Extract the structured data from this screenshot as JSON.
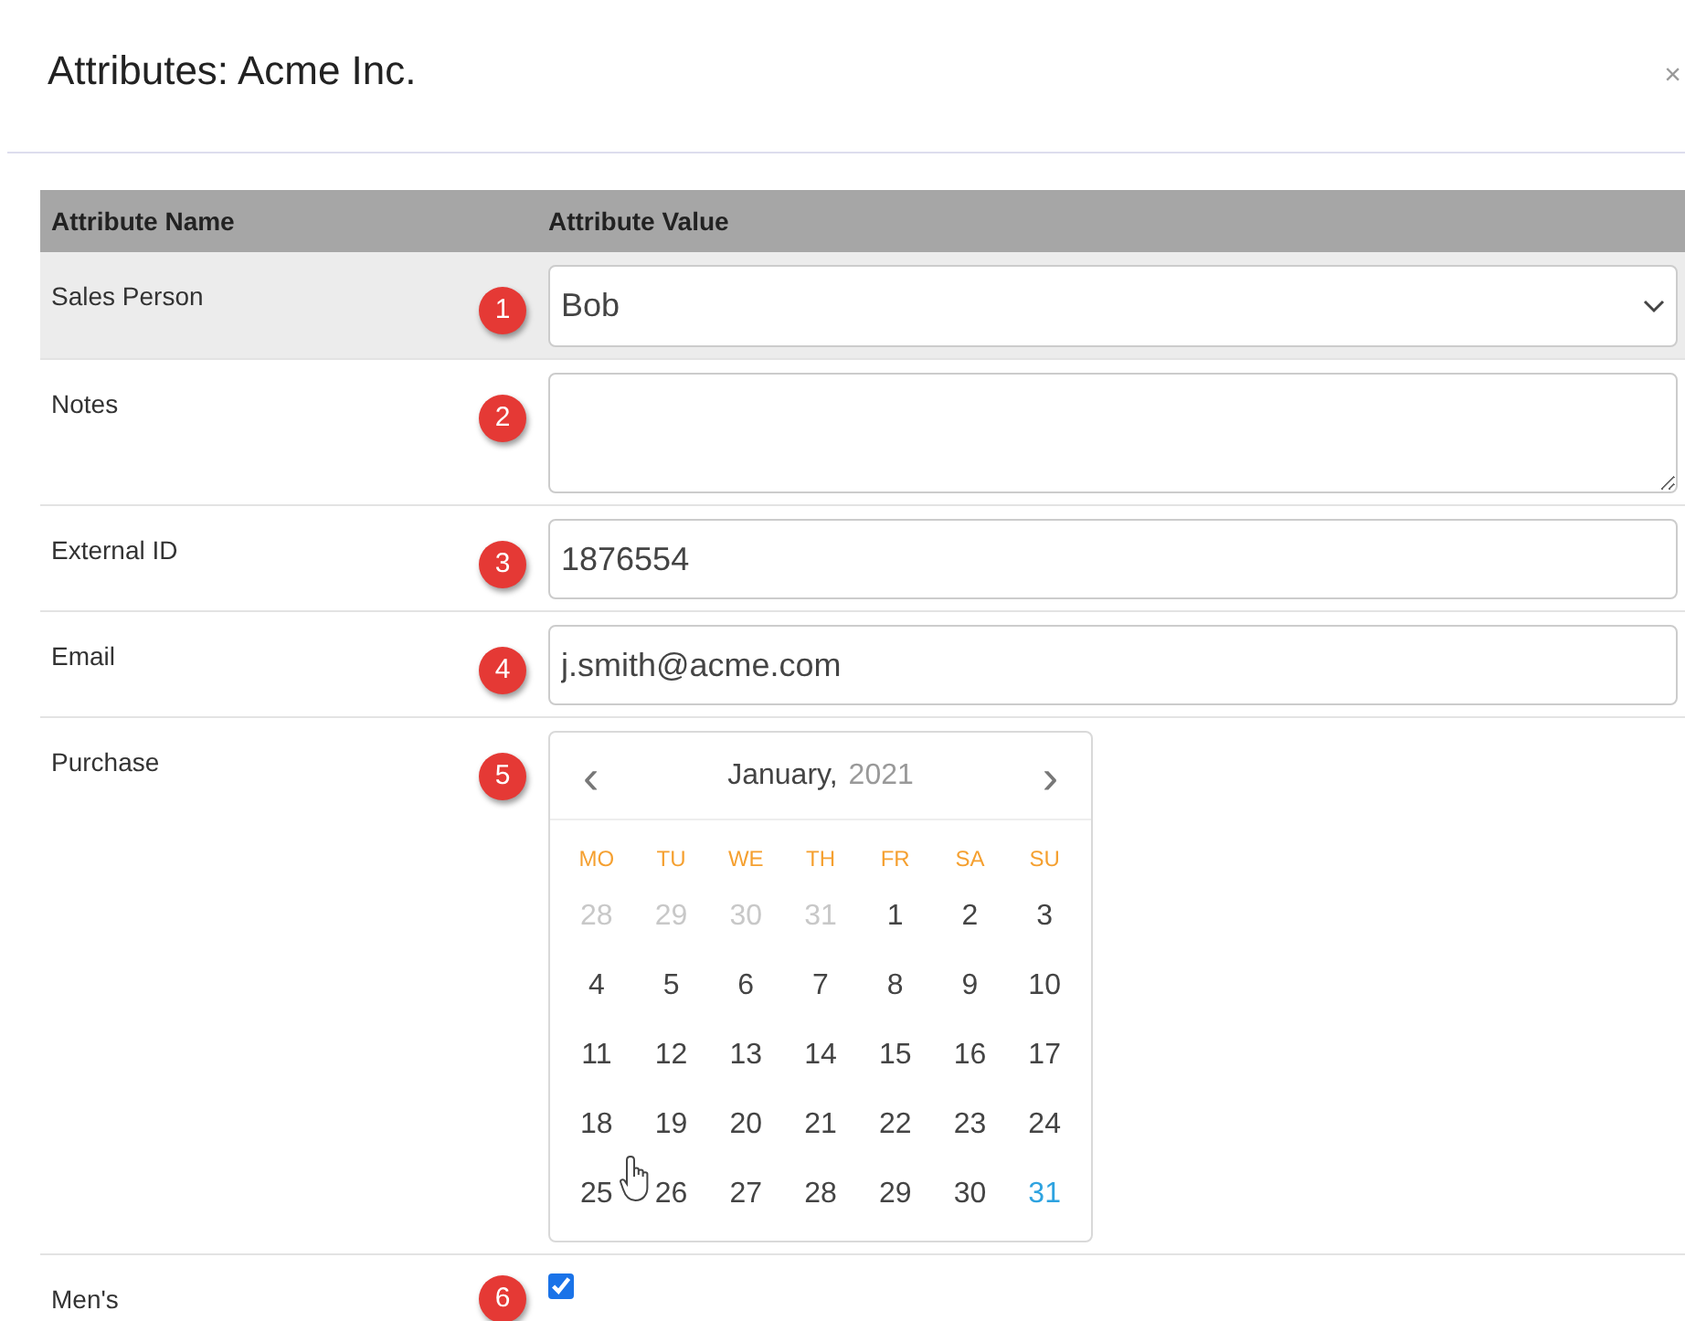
{
  "dialog": {
    "title": "Attributes: Acme Inc.",
    "close": "×"
  },
  "table": {
    "columns": [
      "Attribute Name",
      "Attribute Value"
    ],
    "rows": [
      {
        "name": "Sales Person",
        "badge": "1",
        "kind": "select",
        "value": "Bob",
        "highlighted": true
      },
      {
        "name": "Notes",
        "badge": "2",
        "kind": "textarea",
        "value": "",
        "highlighted": false
      },
      {
        "name": "External ID",
        "badge": "3",
        "kind": "text",
        "value": "1876554",
        "highlighted": false
      },
      {
        "name": "Email",
        "badge": "4",
        "kind": "text",
        "value": "j.smith@acme.com",
        "highlighted": false
      },
      {
        "name": "Purchase",
        "badge": "5",
        "kind": "date",
        "highlighted": false,
        "calendar": {
          "month": "January,",
          "year": "2021",
          "prev": "‹",
          "next": "›",
          "weekdays": [
            "MO",
            "TU",
            "WE",
            "TH",
            "FR",
            "SA",
            "SU"
          ],
          "days": [
            {
              "label": "28",
              "kind": "outside"
            },
            {
              "label": "29",
              "kind": "outside"
            },
            {
              "label": "30",
              "kind": "outside"
            },
            {
              "label": "31",
              "kind": "outside"
            },
            {
              "label": "1",
              "kind": "inside"
            },
            {
              "label": "2",
              "kind": "inside"
            },
            {
              "label": "3",
              "kind": "inside"
            },
            {
              "label": "4",
              "kind": "inside"
            },
            {
              "label": "5",
              "kind": "inside"
            },
            {
              "label": "6",
              "kind": "inside"
            },
            {
              "label": "7",
              "kind": "inside"
            },
            {
              "label": "8",
              "kind": "inside"
            },
            {
              "label": "9",
              "kind": "inside"
            },
            {
              "label": "10",
              "kind": "inside"
            },
            {
              "label": "11",
              "kind": "inside"
            },
            {
              "label": "12",
              "kind": "inside"
            },
            {
              "label": "13",
              "kind": "inside"
            },
            {
              "label": "14",
              "kind": "inside"
            },
            {
              "label": "15",
              "kind": "inside"
            },
            {
              "label": "16",
              "kind": "inside"
            },
            {
              "label": "17",
              "kind": "inside"
            },
            {
              "label": "18",
              "kind": "inside"
            },
            {
              "label": "19",
              "kind": "inside"
            },
            {
              "label": "20",
              "kind": "inside"
            },
            {
              "label": "21",
              "kind": "inside"
            },
            {
              "label": "22",
              "kind": "inside"
            },
            {
              "label": "23",
              "kind": "inside"
            },
            {
              "label": "24",
              "kind": "inside"
            },
            {
              "label": "25",
              "kind": "inside"
            },
            {
              "label": "26",
              "kind": "inside"
            },
            {
              "label": "27",
              "kind": "inside"
            },
            {
              "label": "28",
              "kind": "inside"
            },
            {
              "label": "29",
              "kind": "inside"
            },
            {
              "label": "30",
              "kind": "inside"
            },
            {
              "label": "31",
              "kind": "today"
            }
          ]
        }
      },
      {
        "name": "Men's",
        "badge": "6",
        "kind": "checkbox",
        "checked": true,
        "highlighted": false
      }
    ]
  }
}
